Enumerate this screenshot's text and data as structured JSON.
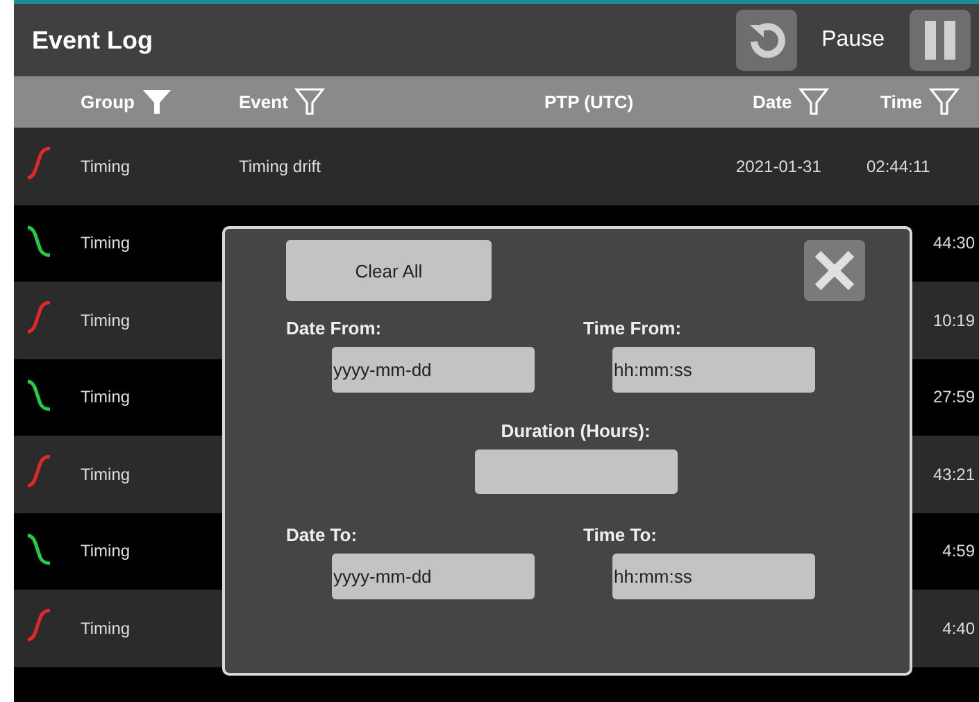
{
  "header": {
    "title": "Event Log",
    "pause_label": "Pause"
  },
  "columns": [
    {
      "label": "Group",
      "filtered": true
    },
    {
      "label": "Event",
      "filtered": false
    },
    {
      "label": "PTP (UTC)"
    },
    {
      "label": "Date",
      "filtered": false
    },
    {
      "label": "Time",
      "filtered": false
    }
  ],
  "rows": [
    {
      "rising": true,
      "group": "Timing",
      "event": "Timing drift",
      "date": "2021-01-31",
      "time": "02:44:11"
    },
    {
      "rising": false,
      "group": "Timing",
      "time": "44:30"
    },
    {
      "rising": true,
      "group": "Timing",
      "time": "10:19"
    },
    {
      "rising": false,
      "group": "Timing",
      "time": "27:59"
    },
    {
      "rising": true,
      "group": "Timing",
      "time": "43:21"
    },
    {
      "rising": false,
      "group": "Timing",
      "time": "4:59"
    },
    {
      "rising": true,
      "group": "Timing",
      "time": "4:40"
    }
  ],
  "dialog": {
    "clear_button": "Clear All",
    "date_from": {
      "label": "Date From:",
      "placeholder": "yyyy-mm-dd"
    },
    "time_from": {
      "label": "Time From:",
      "placeholder": "hh:mm:ss"
    },
    "duration": {
      "label": "Duration (Hours):"
    },
    "date_to": {
      "label": "Date To:",
      "placeholder": "yyyy-mm-dd"
    },
    "time_to": {
      "label": "Time To:",
      "placeholder": "hh:mm:ss"
    }
  }
}
